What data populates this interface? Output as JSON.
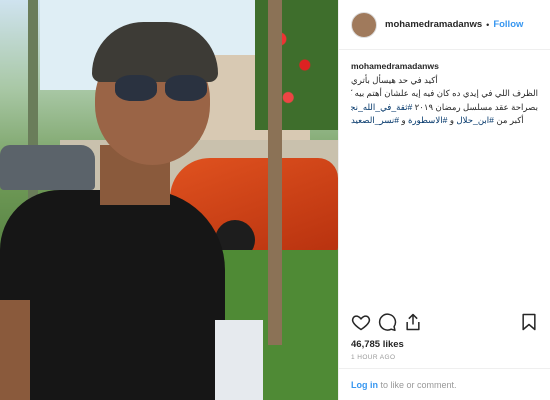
{
  "post": {
    "username": "mohamedramadanws",
    "follow_label": "Follow",
    "separator": "•",
    "caption": {
      "username": "mohamedramadanws",
      "lines": [
        "أكيد في حد هيسأل بأتري",
        "الظرف اللي في إيدي ده كان فيه إيه علشان أهتم بيه كده ؟!",
        "بصراحة عقد مسلسل رمضان ٢٠١٩"
      ],
      "line3_hashtag": "#ثقة_في_الله_نجاح",
      "line4_prefix": "أكبر من",
      "line4_tags": [
        "#ابن_حلال",
        "#الاسطورة",
        "#نسر_الصعيد"
      ],
      "line4_joiner": " و "
    },
    "likes": "46,785 likes",
    "time": "1 HOUR AGO",
    "login_link": "Log in",
    "login_text": " to like or comment."
  },
  "icons": {
    "like": "heart-icon",
    "comment": "comment-icon",
    "share": "share-icon",
    "save": "bookmark-icon"
  }
}
